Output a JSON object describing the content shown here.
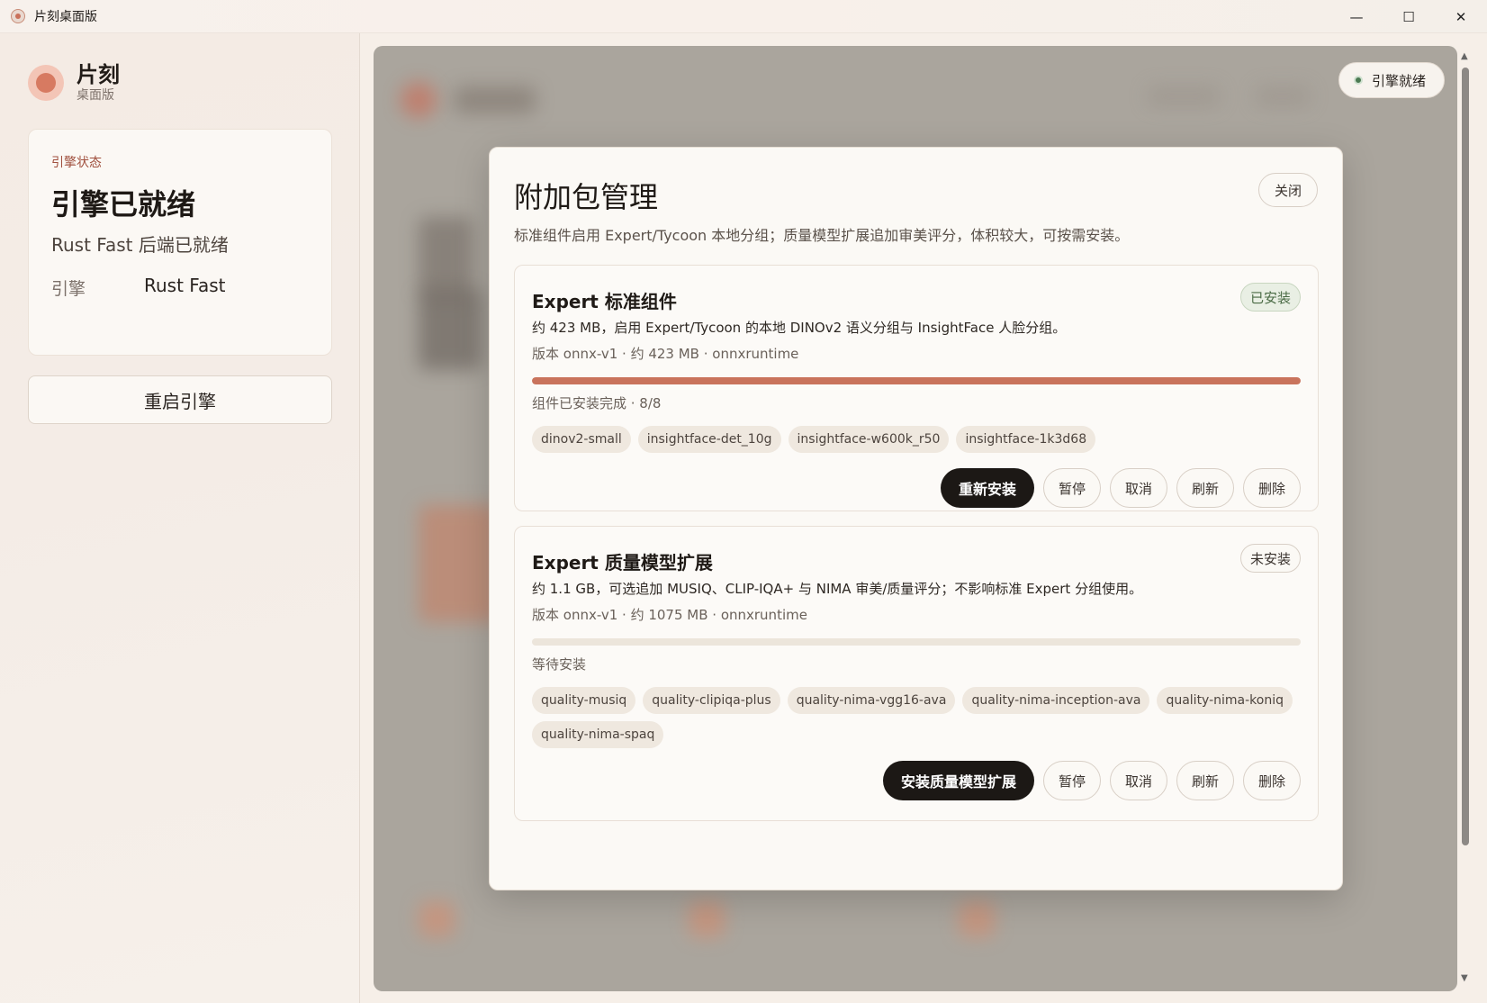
{
  "window": {
    "title": "片刻桌面版",
    "minimize": "—",
    "maximize": "☐",
    "close": "✕"
  },
  "sidebar": {
    "brand_title": "片刻",
    "brand_sub": "桌面版",
    "status_label": "引擎状态",
    "status_title": "引擎已就绪",
    "status_desc": "Rust Fast 后端已就绪",
    "engine_key": "引擎",
    "engine_value": "Rust Fast",
    "restart_label": "重启引擎"
  },
  "pill": {
    "label": "引擎就绪",
    "dot_color": "#4c7a52"
  },
  "modal": {
    "title": "附加包管理",
    "close_label": "关闭",
    "description": "标准组件启用 Expert/Tycoon 本地分组；质量模型扩展追加审美评分，体积较大，可按需安装。",
    "packages": [
      {
        "title": "Expert 标准组件",
        "badge": "已安装",
        "description": "约 423 MB，启用 Expert/Tycoon 的本地 DINOv2 语义分组与 InsightFace 人脸分组。",
        "meta": "版本 onnx-v1 · 约 423 MB · onnxruntime",
        "progress": 1.0,
        "status": "组件已安装完成 · 8/8",
        "chips": [
          "dinov2-small",
          "insightface-det_10g",
          "insightface-w600k_r50",
          "insightface-1k3d68"
        ],
        "primary_label": "重新安装",
        "pause_label": "暂停",
        "cancel_label": "取消",
        "refresh_label": "刷新",
        "delete_label": "删除"
      },
      {
        "title": "Expert 质量模型扩展",
        "badge": "未安装",
        "description": "约 1.1 GB，可选追加 MUSIQ、CLIP-IQA+ 与 NIMA 审美/质量评分；不影响标准 Expert 分组使用。",
        "meta": "版本 onnx-v1 · 约 1075 MB · onnxruntime",
        "progress": 0.0,
        "status": "等待安装",
        "chips": [
          "quality-musiq",
          "quality-clipiqa-plus",
          "quality-nima-vgg16-ava",
          "quality-nima-inception-ava",
          "quality-nima-koniq",
          "quality-nima-spaq"
        ],
        "primary_label": "安装质量模型扩展",
        "pause_label": "暂停",
        "cancel_label": "取消",
        "refresh_label": "刷新",
        "delete_label": "删除"
      }
    ]
  },
  "colors": {
    "accent": "#c9735c",
    "primary_button": "#1c1815",
    "installed_badge": "#4a6b45"
  }
}
